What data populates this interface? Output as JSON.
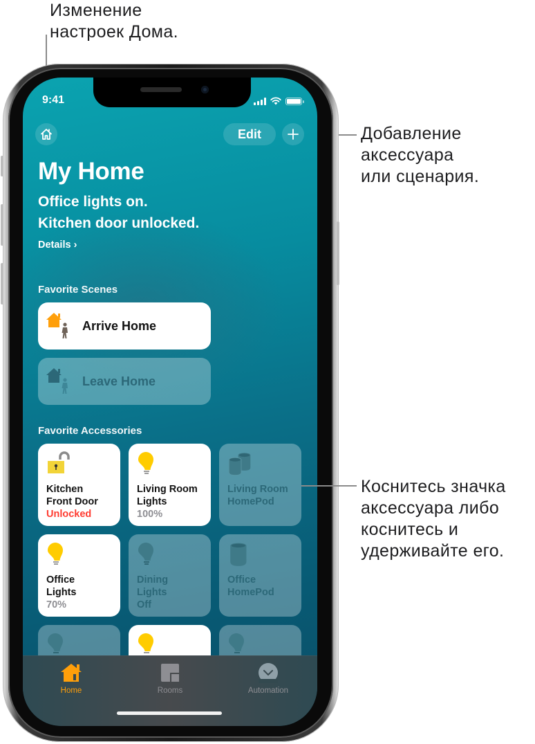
{
  "callouts": {
    "home_settings": [
      "Изменение",
      "настроек Дома."
    ],
    "add": [
      "Добавление",
      "аксессуара",
      "или сценария."
    ],
    "tap_accessory": [
      "Коснитесь значка",
      "аксессуара либо",
      "коснитесь и",
      "удерживайте его."
    ]
  },
  "status_bar": {
    "time": "9:41",
    "icons": [
      "cellular-signal-icon",
      "wifi-icon",
      "battery-icon"
    ]
  },
  "toolbar": {
    "home_icon": "home-settings-icon",
    "edit_label": "Edit",
    "add_label": "+"
  },
  "header": {
    "title": "My Home",
    "summary_lines": [
      "Office lights on.",
      "Kitchen door unlocked."
    ],
    "details_label": "Details ›"
  },
  "scenes": {
    "label": "Favorite Scenes",
    "items": [
      {
        "label": "Arrive Home",
        "active": true,
        "icon": "arrive-home-icon"
      },
      {
        "label": "Leave Home",
        "active": false,
        "icon": "leave-home-icon"
      }
    ]
  },
  "accessories": {
    "label": "Favorite Accessories",
    "items": [
      {
        "name": "Kitchen Front Door",
        "name_lines": [
          "Kitchen",
          "Front Door"
        ],
        "status": "Unlocked",
        "active": true,
        "icon": "unlocked-lock-icon",
        "alert": true
      },
      {
        "name": "Living Room Lights",
        "name_lines": [
          "Living Room",
          "Lights"
        ],
        "status": "100%",
        "active": true,
        "icon": "lightbulb-icon"
      },
      {
        "name": "Living Room HomePod",
        "name_lines": [
          "Living Room",
          "HomePod"
        ],
        "status": "",
        "active": false,
        "icon": "homepod-pair-icon"
      },
      {
        "name": "Office Lights",
        "name_lines": [
          "Office",
          "Lights"
        ],
        "status": "70%",
        "active": true,
        "icon": "lightbulb-icon"
      },
      {
        "name": "Dining Lights",
        "name_lines": [
          "Dining",
          "Lights"
        ],
        "status": "Off",
        "active": false,
        "icon": "lightbulb-icon"
      },
      {
        "name": "Office HomePod",
        "name_lines": [
          "Office",
          "HomePod"
        ],
        "status": "",
        "active": false,
        "icon": "homepod-icon"
      },
      {
        "name": "",
        "status": "",
        "active": false,
        "icon": "lightbulb-icon"
      },
      {
        "name": "",
        "status": "",
        "active": true,
        "icon": "lightbulb-icon"
      },
      {
        "name": "",
        "status": "",
        "active": false,
        "icon": "lightbulb-icon"
      }
    ]
  },
  "tabbar": {
    "tabs": [
      {
        "label": "Home",
        "icon": "home-tab-icon",
        "selected": true
      },
      {
        "label": "Rooms",
        "icon": "rooms-tab-icon",
        "selected": false
      },
      {
        "label": "Automation",
        "icon": "automation-tab-icon",
        "selected": false
      }
    ]
  },
  "colors": {
    "accent": "#ff9f0a",
    "bulb_on": "#ffcc00",
    "alert": "#ff3b30",
    "lock_body": "#f2d438"
  }
}
